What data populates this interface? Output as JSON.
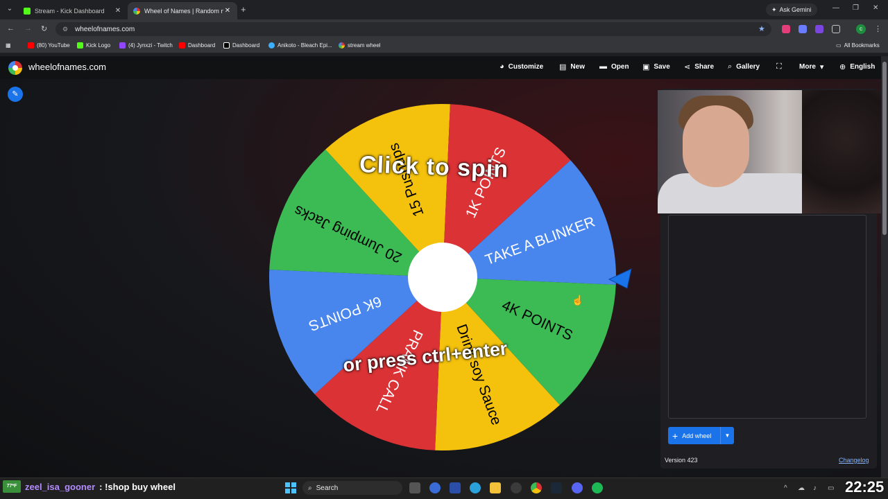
{
  "browser": {
    "tabs": [
      {
        "title": "Stream - Kick Dashboard",
        "active": false,
        "favicon_color": "#53fc18"
      },
      {
        "title": "Wheel of Names | Random nam",
        "active": true,
        "favicon_color": "#db3236"
      }
    ],
    "ask_gemini": "Ask Gemini",
    "url": "wheelofnames.com",
    "profile_initial": "c",
    "bookmarks": [
      {
        "label": "(80) YouTube",
        "color": "#ff0000"
      },
      {
        "label": "Kick Logo",
        "color": "#53fc18"
      },
      {
        "label": "(4) Jynxzi - Twitch",
        "color": "#9146ff"
      },
      {
        "label": "Dashboard",
        "color": "#ff0000"
      },
      {
        "label": "Dashboard",
        "color": "#000000"
      },
      {
        "label": "Anikoto - Bleach Epi...",
        "color": "#3ab0ff"
      },
      {
        "label": "stream wheel",
        "color": "#db3236"
      }
    ],
    "all_bookmarks": "All Bookmarks"
  },
  "site": {
    "title": "wheelofnames.com",
    "menu": [
      {
        "label": "Customize",
        "icon": "palette-icon"
      },
      {
        "label": "New",
        "icon": "new-file-icon"
      },
      {
        "label": "Open",
        "icon": "folder-icon"
      },
      {
        "label": "Save",
        "icon": "save-icon"
      },
      {
        "label": "Share",
        "icon": "share-icon"
      },
      {
        "label": "Gallery",
        "icon": "search-icon"
      },
      {
        "label": "",
        "icon": "fullscreen-icon"
      },
      {
        "label": "More",
        "icon": "chevron-down-icon"
      },
      {
        "label": "English",
        "icon": "globe-icon"
      }
    ]
  },
  "wheel": {
    "overlay_top": "Click to spin",
    "overlay_bottom": "or press ctrl+enter",
    "colors": {
      "green": "#3cba54",
      "yellow": "#f4c20d",
      "red": "#db3236",
      "blue": "#4885ed"
    },
    "segments": [
      {
        "label": "TAKE A BLINKER",
        "color": "#4885ed",
        "text_color": "#ffffff"
      },
      {
        "label": "4K POINTS",
        "color": "#3cba54",
        "text_color": "#000000"
      },
      {
        "label": "Drink soy Sauce",
        "color": "#f4c20d",
        "text_color": "#000000"
      },
      {
        "label": "PRANK CALL",
        "color": "#db3236",
        "text_color": "#ffffff"
      },
      {
        "label": "6K POINTS",
        "color": "#4885ed",
        "text_color": "#ffffff"
      },
      {
        "label": "20 Jumping Jacks",
        "color": "#3cba54",
        "text_color": "#000000"
      },
      {
        "label": "15 Pushups",
        "color": "#f4c20d",
        "text_color": "#000000"
      },
      {
        "label": "1K POINTS",
        "color": "#db3236",
        "text_color": "#ffffff"
      }
    ]
  },
  "panel": {
    "add_wheel": "Add wheel",
    "version": "Version 423",
    "changelog": "Changelog"
  },
  "taskbar": {
    "chat_badge": "77*F",
    "chat_user": "zeel_isa_gooner",
    "chat_message": ": !shop buy wheel",
    "search_label": "Search",
    "clock": "22:25"
  }
}
